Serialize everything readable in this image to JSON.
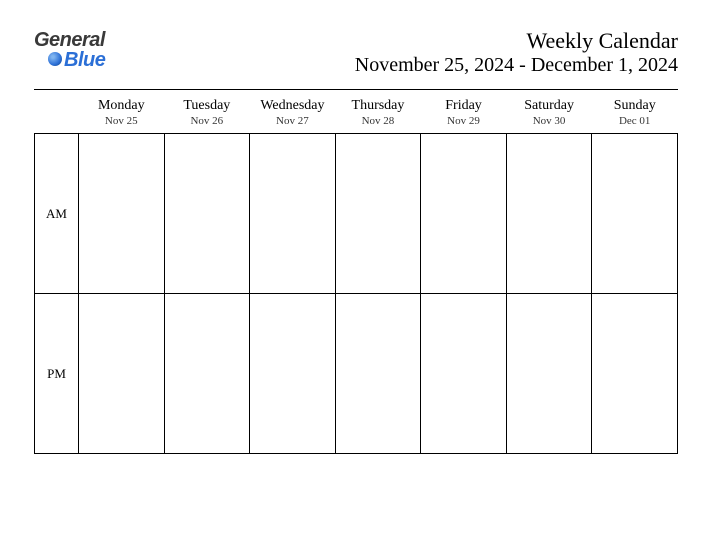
{
  "logo": {
    "top": "General",
    "bottom": "Blue"
  },
  "title": {
    "main": "Weekly Calendar",
    "range": "November 25, 2024 - December 1, 2024"
  },
  "days": [
    {
      "name": "Monday",
      "date": "Nov 25"
    },
    {
      "name": "Tuesday",
      "date": "Nov 26"
    },
    {
      "name": "Wednesday",
      "date": "Nov 27"
    },
    {
      "name": "Thursday",
      "date": "Nov 28"
    },
    {
      "name": "Friday",
      "date": "Nov 29"
    },
    {
      "name": "Saturday",
      "date": "Nov 30"
    },
    {
      "name": "Sunday",
      "date": "Dec 01"
    }
  ],
  "periods": [
    "AM",
    "PM"
  ]
}
